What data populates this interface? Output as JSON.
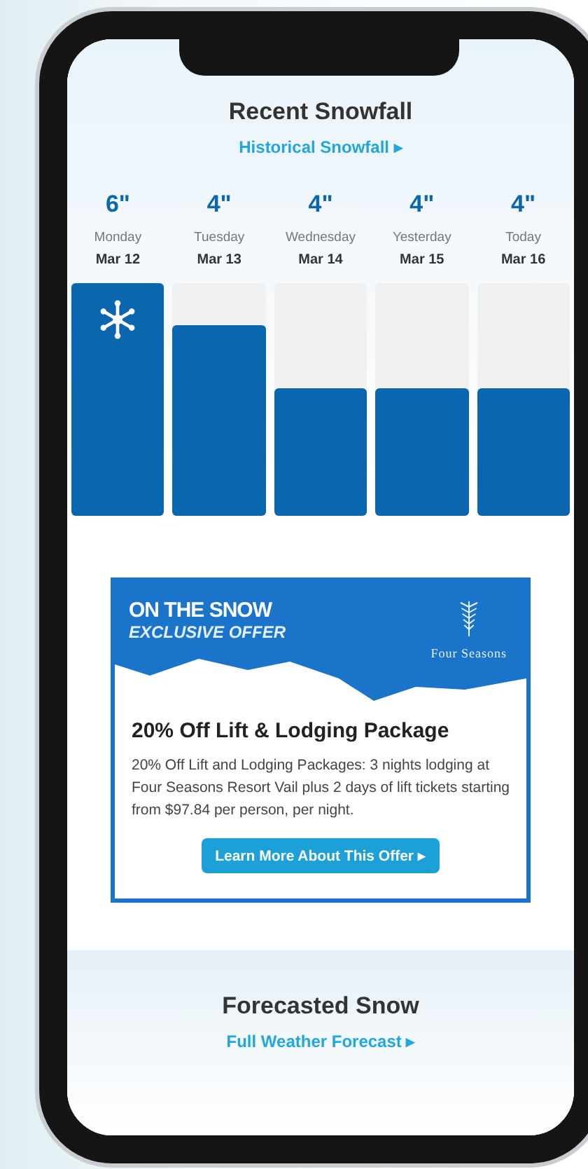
{
  "recent": {
    "title": "Recent Snowfall",
    "link": "Historical Snowfall ▸"
  },
  "days": [
    {
      "amount": "6\"",
      "day": "Monday",
      "date": "Mar 12",
      "level": 1,
      "snowflake": true
    },
    {
      "amount": "4\"",
      "day": "Tuesday",
      "date": "Mar 13",
      "level": 0.82,
      "snowflake": false
    },
    {
      "amount": "4\"",
      "day": "Wednesday",
      "date": "Mar 14",
      "level": 0.55,
      "snowflake": false
    },
    {
      "amount": "4\"",
      "day": "Yesterday",
      "date": "Mar 15",
      "level": 0.55,
      "snowflake": false
    },
    {
      "amount": "4\"",
      "day": "Today",
      "date": "Mar 16",
      "level": 0.55,
      "snowflake": false
    }
  ],
  "offer": {
    "brand": "ON THE SNOW",
    "tagline": "EXCLUSIVE OFFER",
    "partner": "Four Seasons",
    "title": "20% Off Lift & Lodging Package",
    "text": "20% Off Lift and Lodging Packages: 3 nights lodging at Four Seasons Resort Vail plus 2 days of lift tickets starting from $97.84 per person, per night.",
    "button": "Learn More About This Offer ▸"
  },
  "forecast": {
    "title": "Forecasted Snow",
    "link": "Full Weather Forecast ▸"
  }
}
